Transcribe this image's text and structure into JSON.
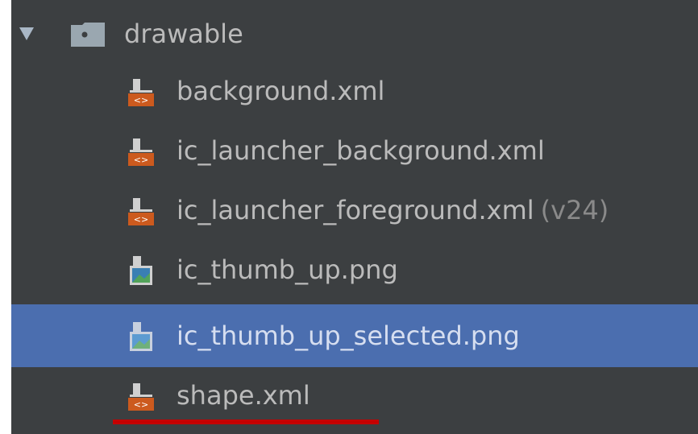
{
  "tree": {
    "folder": {
      "label": "drawable",
      "expanded": true
    },
    "files": [
      {
        "label": "background.xml",
        "qualifier": "",
        "type": "xml",
        "selected": false
      },
      {
        "label": "ic_launcher_background.xml",
        "qualifier": "",
        "type": "xml",
        "selected": false
      },
      {
        "label": "ic_launcher_foreground.xml",
        "qualifier": "(v24)",
        "type": "xml",
        "selected": false
      },
      {
        "label": "ic_thumb_up.png",
        "qualifier": "",
        "type": "png",
        "selected": false
      },
      {
        "label": "ic_thumb_up_selected.png",
        "qualifier": "",
        "type": "png",
        "selected": true
      },
      {
        "label": "shape.xml",
        "qualifier": "",
        "type": "xml",
        "selected": false
      }
    ]
  },
  "colors": {
    "panel_bg": "#3c3f41",
    "selection_bg": "#4b6eaf",
    "text": "#bbbbbb",
    "xml_badge": "#cc5a1e",
    "annotation_underline": "#c40000"
  },
  "icons": {
    "expand": "chevron-down-icon",
    "folder": "folder-icon",
    "xml": "xml-file-icon",
    "png": "image-file-icon"
  }
}
